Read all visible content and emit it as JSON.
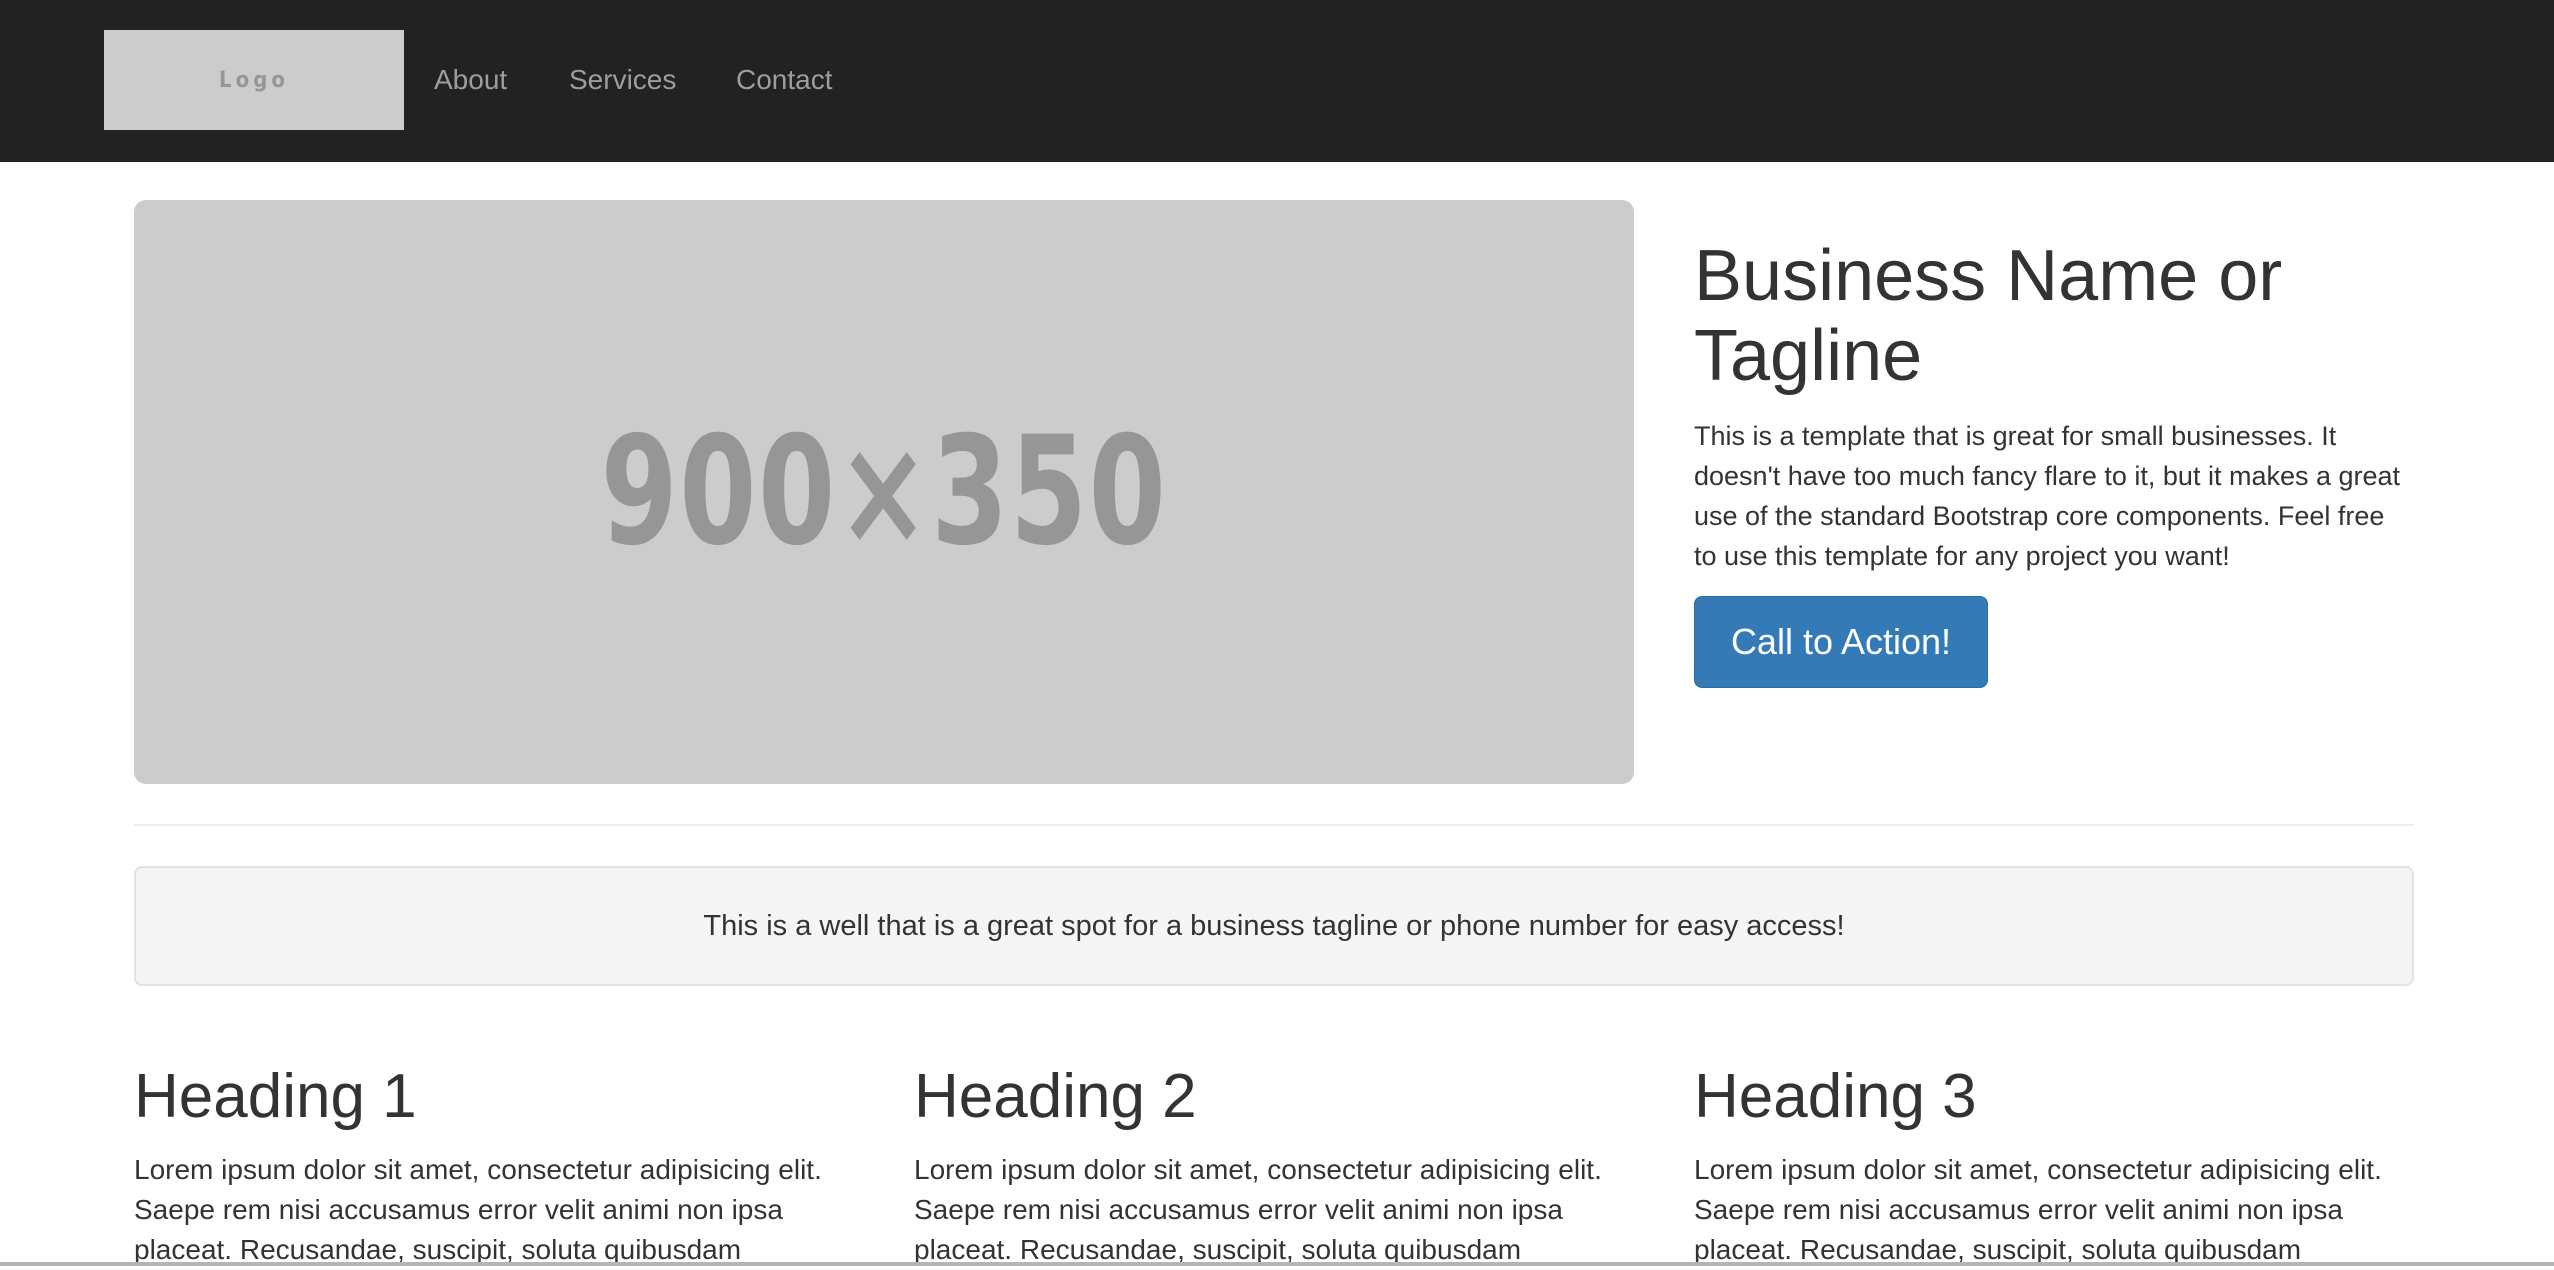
{
  "navbar": {
    "logo_text": "Logo",
    "links": [
      {
        "label": "About"
      },
      {
        "label": "Services"
      },
      {
        "label": "Contact"
      }
    ]
  },
  "hero": {
    "image_label": "900×350",
    "title": "Business Name or Tagline",
    "text": "This is a template that is great for small businesses. It doesn't have too much fancy flare to it, but it makes a great use of the standard Bootstrap core components. Feel free to use this template for any project you want!",
    "cta_label": "Call to Action!"
  },
  "well": {
    "text": "This is a well that is a great spot for a business tagline or phone number for easy access!"
  },
  "columns": [
    {
      "heading": "Heading 1",
      "text": "Lorem ipsum dolor sit amet, consectetur adipisicing elit. Saepe rem nisi accusamus error velit animi non ipsa placeat. Recusandae, suscipit, soluta quibusdam"
    },
    {
      "heading": "Heading 2",
      "text": "Lorem ipsum dolor sit amet, consectetur adipisicing elit. Saepe rem nisi accusamus error velit animi non ipsa placeat. Recusandae, suscipit, soluta quibusdam"
    },
    {
      "heading": "Heading 3",
      "text": "Lorem ipsum dolor sit amet, consectetur adipisicing elit. Saepe rem nisi accusamus error velit animi non ipsa placeat. Recusandae, suscipit, soluta quibusdam"
    }
  ],
  "colors": {
    "navbar_bg": "#222222",
    "nav_link": "#9d9d9d",
    "placeholder_bg": "#cccccc",
    "placeholder_text": "#969696",
    "primary": "#337ab7",
    "well_bg": "#f5f5f5",
    "text": "#333333"
  }
}
